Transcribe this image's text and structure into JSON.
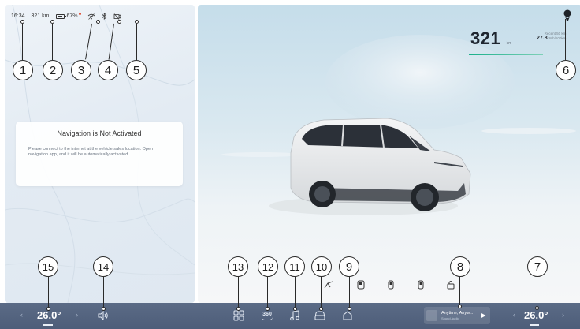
{
  "status_bar": {
    "time": "16:34",
    "range": "321 km",
    "battery": "67%",
    "icons": [
      "wifi-icon",
      "bluetooth-icon",
      "camera-off-icon"
    ]
  },
  "navigation": {
    "title": "Navigation is Not Activated",
    "body": "Please connect to the internet at the vehicle sales location. Open navigation app, and it will be automatically activated."
  },
  "vehicle": {
    "range_value": "321",
    "range_unit": "km",
    "trip_label": "Recent 50 km",
    "trip_value": "27.8",
    "trip_unit": "kWh/100km",
    "accent_color": "#1bb08a"
  },
  "quick_controls": [
    "wiper-icon",
    "door-icon",
    "window-left-icon",
    "window-right-icon",
    "lock-icon"
  ],
  "dock": {
    "left_temp": "26.0°",
    "right_temp": "26.0°",
    "apps": [
      "app-grid-icon",
      "360-view-icon",
      "music-icon",
      "vehicle-icon",
      "home-icon"
    ],
    "app_360_label": "360",
    "media_title": "Anytime, Anyw...",
    "media_subtitle": "Sound Audio",
    "background_color": "#52627e"
  },
  "callouts": [
    "1",
    "2",
    "3",
    "4",
    "5",
    "6",
    "7",
    "8",
    "9",
    "10",
    "11",
    "12",
    "13",
    "14",
    "15"
  ]
}
